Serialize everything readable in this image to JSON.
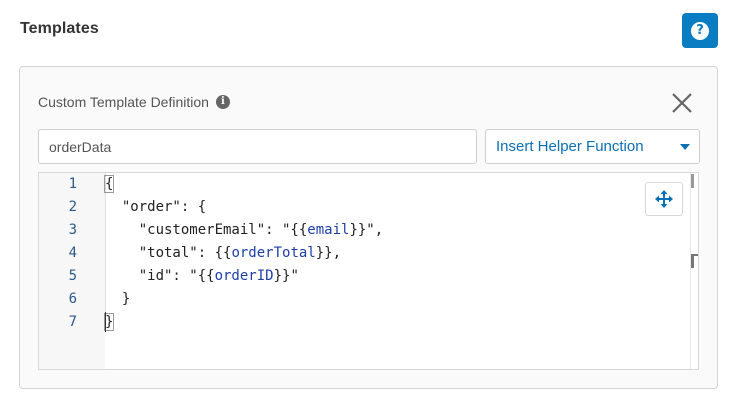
{
  "header": {
    "title": "Templates",
    "help_label": "?"
  },
  "panel": {
    "title": "Custom Template Definition",
    "info_label": "i",
    "name_input": {
      "value": "orderData",
      "placeholder": ""
    },
    "helper_dropdown": {
      "label": "Insert Helper Function"
    }
  },
  "editor": {
    "line_numbers": [
      "1",
      "2",
      "3",
      "4",
      "5",
      "6",
      "7"
    ],
    "lines": [
      [
        {
          "t": "{",
          "c": "plain"
        }
      ],
      [
        {
          "t": "  \"order\": {",
          "c": "plain"
        }
      ],
      [
        {
          "t": "    \"customerEmail\": \"{{",
          "c": "plain"
        },
        {
          "t": "email",
          "c": "var"
        },
        {
          "t": "}}\",",
          "c": "plain"
        }
      ],
      [
        {
          "t": "    \"total\": {{",
          "c": "plain"
        },
        {
          "t": "orderTotal",
          "c": "var"
        },
        {
          "t": "}},",
          "c": "plain"
        }
      ],
      [
        {
          "t": "    \"id\": \"{{",
          "c": "plain"
        },
        {
          "t": "orderID",
          "c": "var"
        },
        {
          "t": "}}\"",
          "c": "plain"
        }
      ],
      [
        {
          "t": "  }",
          "c": "plain"
        }
      ],
      [
        {
          "t": "}",
          "c": "plain"
        }
      ]
    ]
  },
  "colors": {
    "accent": "#0a7cc1",
    "link": "#0a6fb3",
    "template_variable": "#1d3fa6"
  },
  "icons": {
    "help": "question-icon",
    "info": "info-icon",
    "close": "close-icon",
    "move": "move-arrows-icon",
    "caret": "caret-down-icon"
  }
}
